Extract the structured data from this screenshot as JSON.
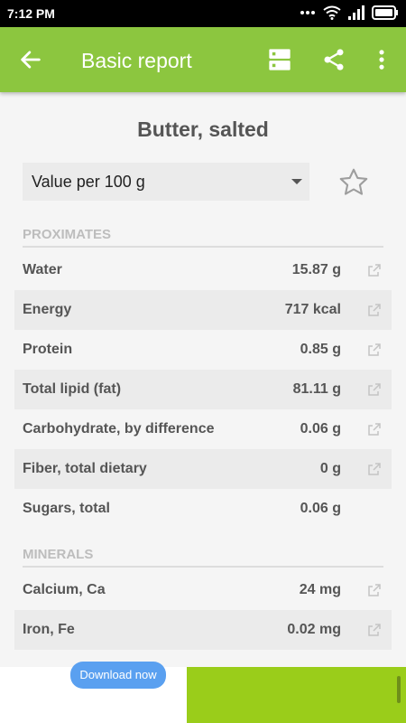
{
  "status_bar": {
    "time": "7:12 PM"
  },
  "app_bar": {
    "title": "Basic report",
    "icons": [
      "back-arrow-icon",
      "layout-icon",
      "share-icon",
      "more-vert-icon"
    ]
  },
  "food": {
    "name": "Butter, salted",
    "serving": "Value per 100 g"
  },
  "sections": [
    {
      "title": "PROXIMATES",
      "rows": [
        {
          "name": "Water",
          "value": "15.87 g"
        },
        {
          "name": "Energy",
          "value": "717 kcal"
        },
        {
          "name": "Protein",
          "value": "0.85 g"
        },
        {
          "name": "Total lipid (fat)",
          "value": "81.11 g"
        },
        {
          "name": "Carbohydrate, by difference",
          "value": "0.06 g"
        },
        {
          "name": "Fiber, total dietary",
          "value": "0 g"
        },
        {
          "name": "Sugars, total",
          "value": "0.06 g"
        }
      ]
    },
    {
      "title": "MINERALS",
      "rows": [
        {
          "name": "Calcium, Ca",
          "value": "24 mg"
        },
        {
          "name": "Iron, Fe",
          "value": "0.02 mg"
        }
      ]
    }
  ],
  "ad": {
    "button_label": "Download now"
  },
  "colors": {
    "accent": "#8cc63f",
    "ad_background": "#9acd1a"
  }
}
